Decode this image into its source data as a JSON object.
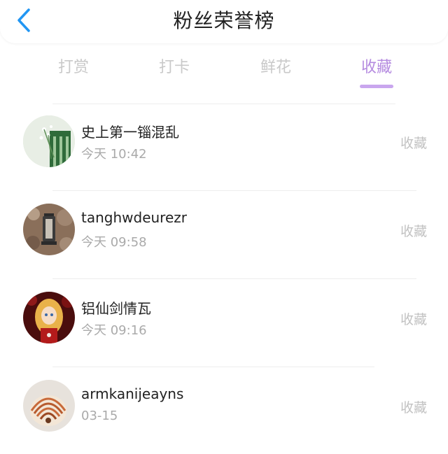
{
  "header": {
    "title": "粉丝荣誉榜"
  },
  "tabs": [
    {
      "label": "打赏",
      "active": false
    },
    {
      "label": "打卡",
      "active": false
    },
    {
      "label": "鲜花",
      "active": false
    },
    {
      "label": "收藏",
      "active": true
    }
  ],
  "colors": {
    "accent": "#b58be0",
    "back_icon": "#2196f3",
    "muted": "#c2c2c2"
  },
  "list": {
    "items": [
      {
        "name": "史上第一锱混乱",
        "time": "今天 10:42",
        "action": "收藏",
        "avatar": "green-plant-avatar"
      },
      {
        "name": "tanghwdeurezr",
        "time": "今天 09:58",
        "action": "收藏",
        "avatar": "lantern-avatar"
      },
      {
        "name": "铝仙剑情瓦",
        "time": "今天 09:16",
        "action": "收藏",
        "avatar": "anime-girl-avatar"
      },
      {
        "name": "armkanijeayns",
        "time": "03-15",
        "action": "收藏",
        "avatar": "shell-avatar"
      }
    ]
  }
}
